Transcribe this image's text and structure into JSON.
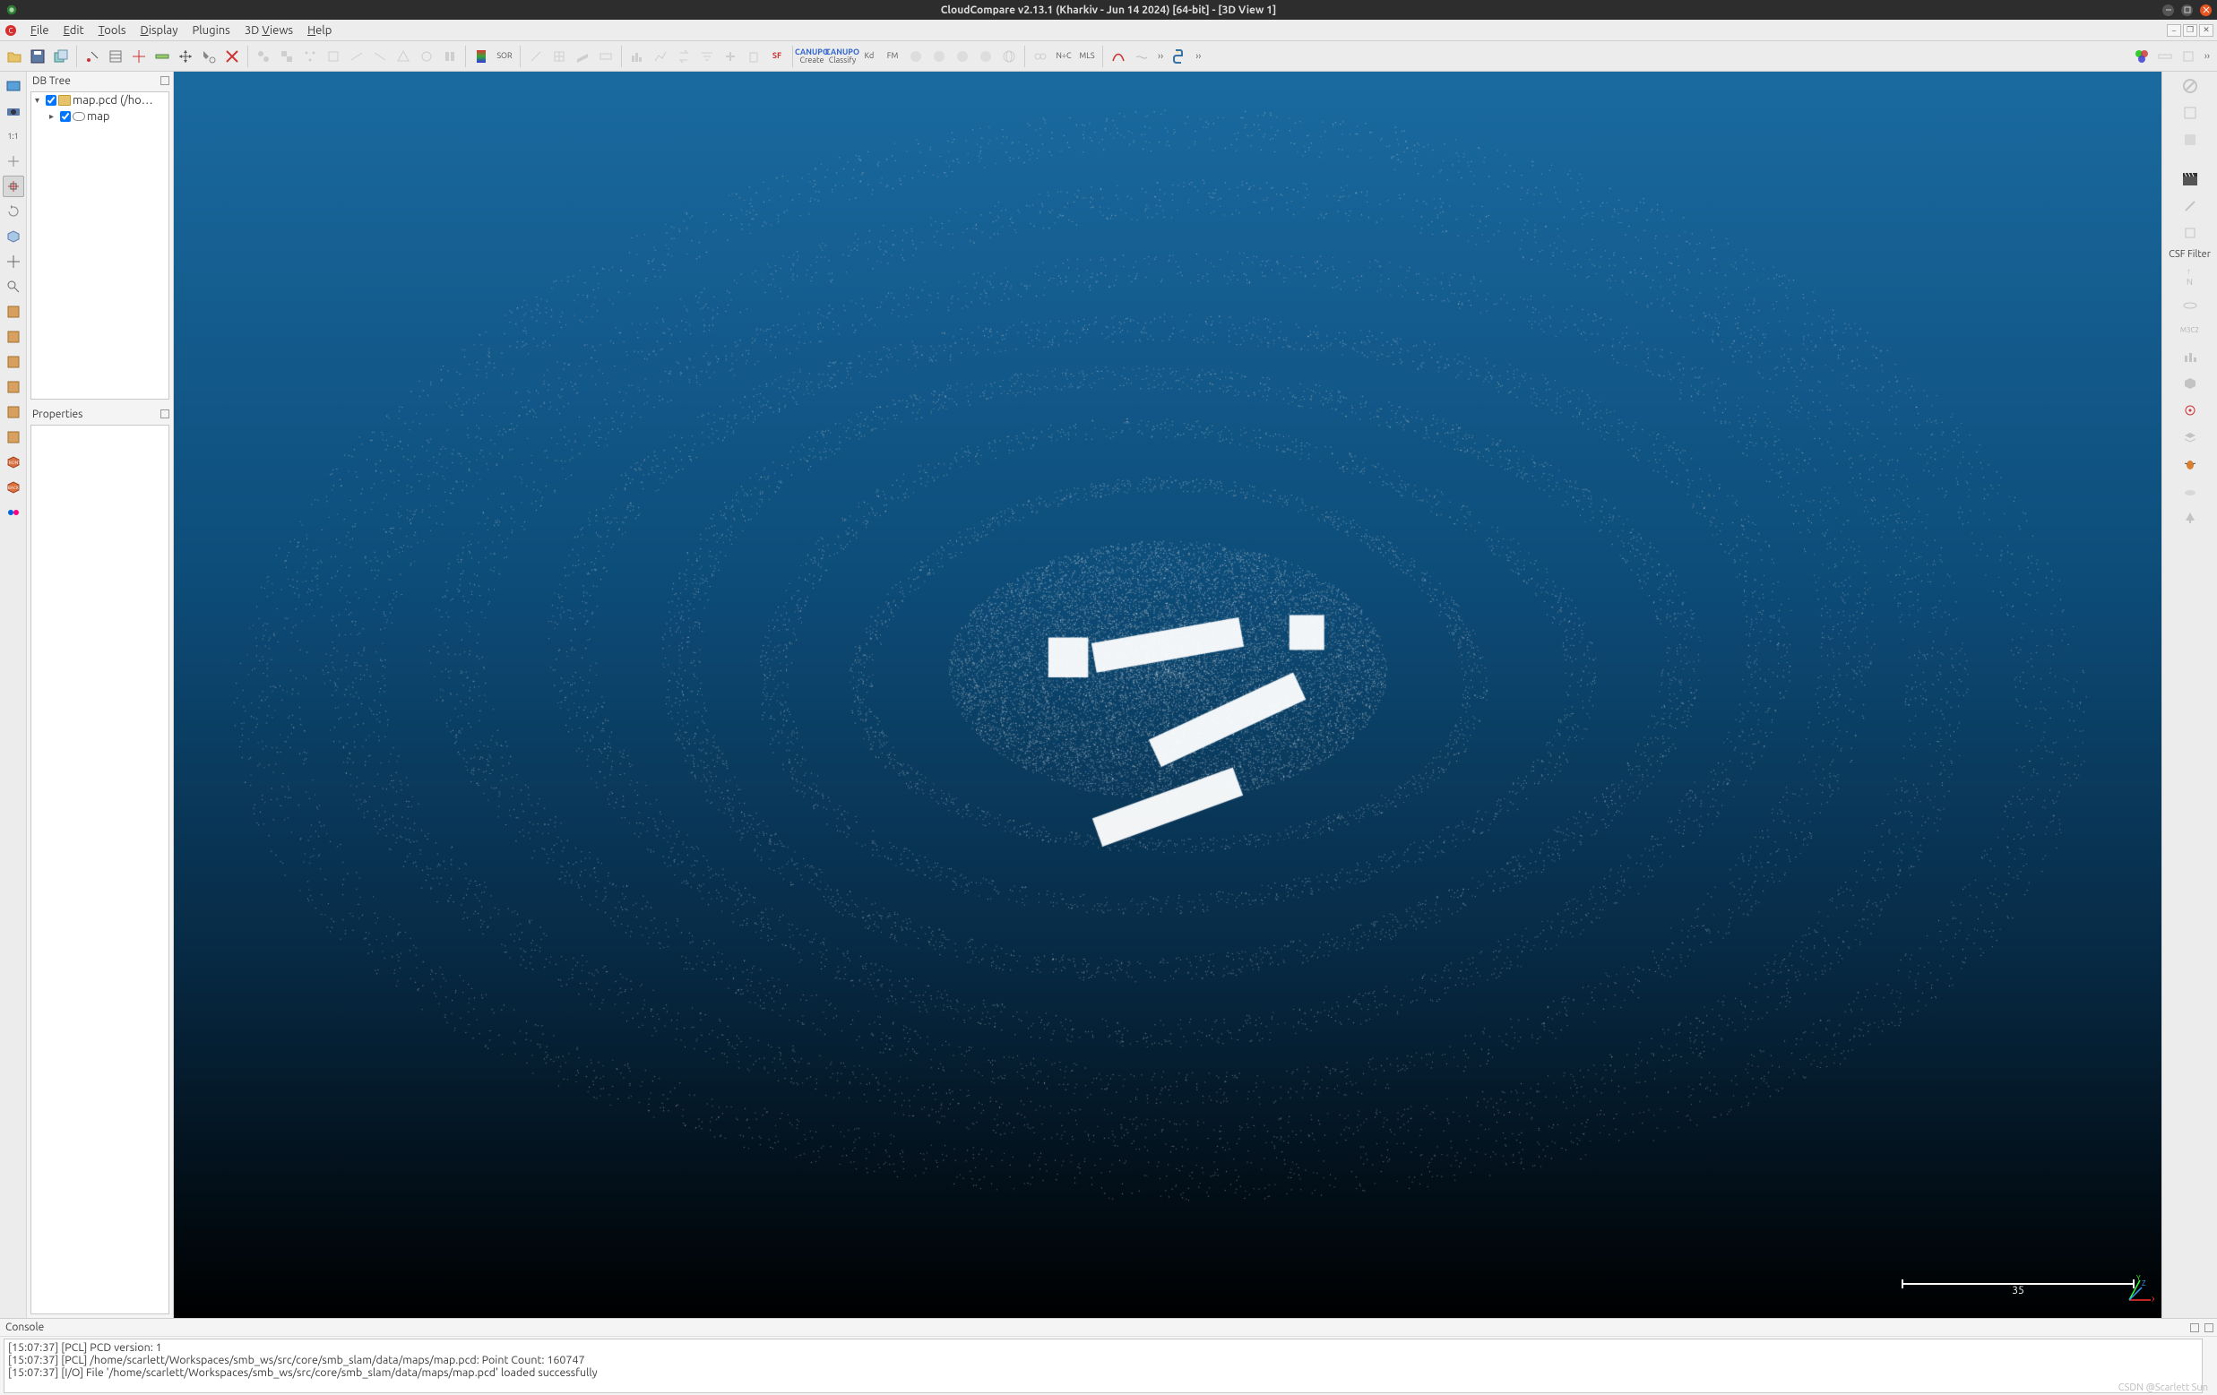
{
  "window": {
    "title": "CloudCompare v2.13.1 (Kharkiv - Jun 14 2024) [64-bit] - [3D View 1]"
  },
  "menu": {
    "items": [
      "File",
      "Edit",
      "Tools",
      "Display",
      "Plugins",
      "3D Views",
      "Help"
    ]
  },
  "main_toolbar_labels": {
    "sor": "SOR",
    "sf": "SF",
    "canupo_create": "Create",
    "canupo_classify": "Classify",
    "kd": "Kd",
    "fm": "FM",
    "nc": "N÷C",
    "mls": "MLS"
  },
  "panels": {
    "dbtree_title": "DB Tree",
    "properties_title": "Properties",
    "console_title": "Console"
  },
  "tree": {
    "root_label": "map.pcd (/ho…",
    "child_label": "map"
  },
  "viewport": {
    "scalebar_value": "35",
    "axes": {
      "x": "X",
      "y": "Y",
      "z": "Z"
    }
  },
  "right_toolbar": {
    "csf_label": "CSF Filter",
    "n_label": "N"
  },
  "console_lines": [
    "[15:07:37] [PCL] PCD version: 1",
    "[15:07:37] [PCL] /home/scarlett/Workspaces/smb_ws/src/core/smb_slam/data/maps/map.pcd: Point Count: 160747",
    "[15:07:37] [I/O] File '/home/scarlett/Workspaces/smb_ws/src/core/smb_slam/data/maps/map.pcd' loaded successfully"
  ],
  "watermark": "CSDN @Scarlett Sun"
}
